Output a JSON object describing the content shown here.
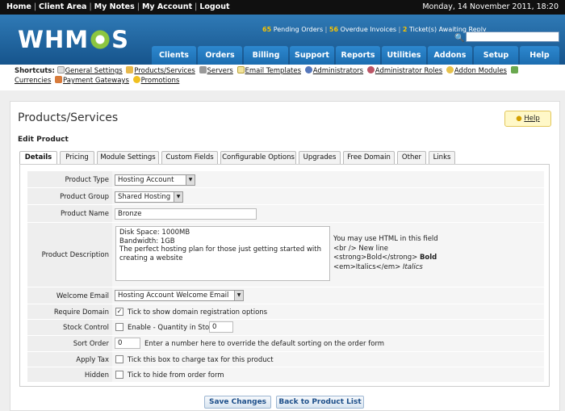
{
  "topbar": {
    "links": [
      "Home",
      "Client Area",
      "My Notes",
      "My Account",
      "Logout"
    ],
    "date": "Monday, 14 November 2011, 18:20"
  },
  "header": {
    "logo_left": "WHM",
    "logo_right": "S",
    "stats": {
      "pending_orders_count": "65",
      "pending_orders_label": "Pending Orders",
      "overdue_invoices_count": "56",
      "overdue_invoices_label": "Overdue Invoices",
      "tickets_count": "2",
      "tickets_label": "Ticket(s) Awaiting Reply"
    },
    "search_value": ""
  },
  "nav": {
    "tabs": [
      "Clients",
      "Orders",
      "Billing",
      "Support",
      "Reports",
      "Utilities",
      "Addons",
      "Setup",
      "Help"
    ]
  },
  "shortcuts": {
    "label": "Shortcuts:",
    "items": [
      "General Settings",
      "Products/Services",
      "Servers",
      "Email Templates",
      "Administrators",
      "Administrator Roles",
      "Addon Modules",
      "Currencies",
      "Payment Gateways",
      "Promotions"
    ]
  },
  "page": {
    "title": "Products/Services",
    "help": "Help",
    "subtitle": "Edit Product"
  },
  "tabs": [
    "Details",
    "Pricing",
    "Module Settings",
    "Custom Fields",
    "Configurable Options",
    "Upgrades",
    "Free Domain",
    "Other",
    "Links"
  ],
  "form": {
    "product_type": {
      "label": "Product Type",
      "value": "Hosting Account"
    },
    "product_group": {
      "label": "Product Group",
      "value": "Shared Hosting"
    },
    "product_name": {
      "label": "Product Name",
      "value": "Bronze"
    },
    "product_description": {
      "label": "Product Description",
      "value": "Disk Space: 1000MB\nBandwidth: 1GB\nThe perfect hosting plan for those just getting started with creating a website",
      "help_1": "You may use HTML in this field",
      "help_2": "<br /> New line",
      "help_3": "<strong>Bold</strong>",
      "help_3_bold": "Bold",
      "help_4": "<em>Italics</em>",
      "help_4_italic": "Italics"
    },
    "welcome_email": {
      "label": "Welcome Email",
      "value": "Hosting Account Welcome Email"
    },
    "require_domain": {
      "label": "Require Domain",
      "text": "Tick to show domain registration options",
      "checked": true
    },
    "stock_control": {
      "label": "Stock Control",
      "text": "Enable - Quantity in Stock:",
      "quantity": "0",
      "checked": false
    },
    "sort_order": {
      "label": "Sort Order",
      "value": "0",
      "text": "Enter a number here to override the default sorting on the order form"
    },
    "apply_tax": {
      "label": "Apply Tax",
      "text": "Tick this box to charge tax for this product",
      "checked": false
    },
    "hidden": {
      "label": "Hidden",
      "text": "Tick to hide from order form",
      "checked": false
    }
  },
  "buttons": {
    "save": "Save Changes",
    "back": "Back to Product List"
  },
  "colors": {
    "header_blue": "#1f65a3",
    "nav_tab": "#2479bf",
    "accent_yellow": "#f8c400",
    "logo_green": "#8cc63f"
  }
}
